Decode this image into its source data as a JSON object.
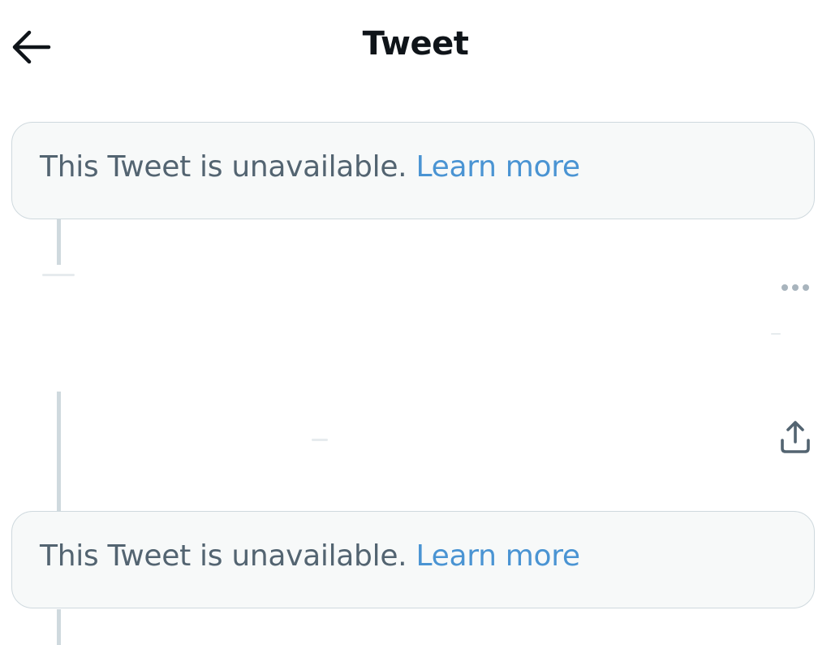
{
  "header": {
    "title": "Tweet",
    "back_icon": "arrow-left-icon"
  },
  "notices": [
    {
      "text": "This Tweet is unavailable.",
      "link": "Learn more"
    },
    {
      "text": "This Tweet is unavailable.",
      "link": "Learn more"
    }
  ],
  "tweet": {
    "more_icon": "more-horizontal-icon",
    "share_icon": "share-icon"
  },
  "colors": {
    "text_primary": "#0f1419",
    "text_secondary": "#536471",
    "link": "#4a94d3",
    "card_background": "#f7f9f9",
    "card_border": "#cfd9de",
    "thread_line": "#cfd9de",
    "icon_gray": "#a8b4bd"
  }
}
